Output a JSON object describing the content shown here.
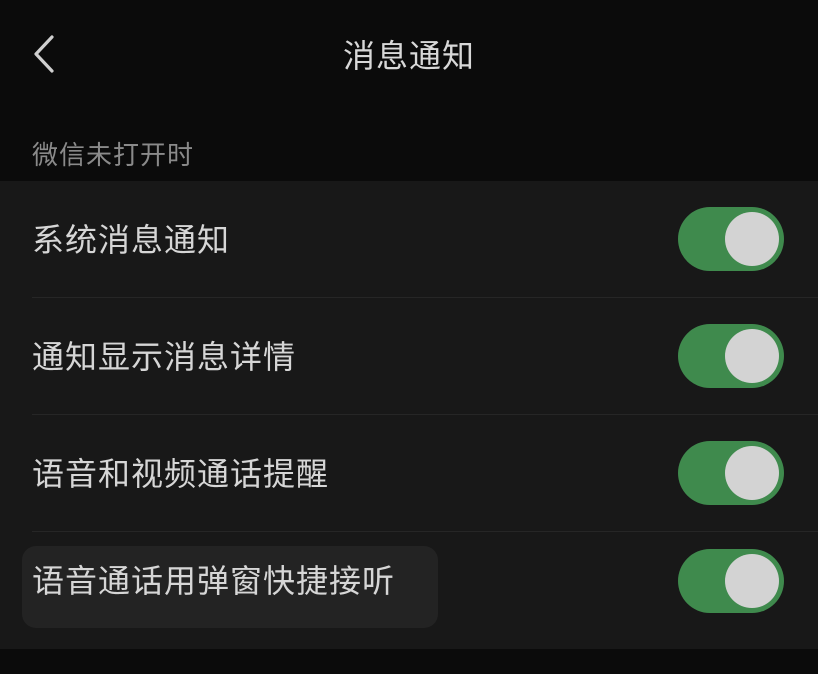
{
  "header": {
    "back_icon": "chevron-left-icon",
    "title": "消息通知"
  },
  "section": {
    "title": "微信未打开时"
  },
  "settings": [
    {
      "label": "系统消息通知",
      "enabled": true
    },
    {
      "label": "通知显示消息详情",
      "enabled": true
    },
    {
      "label": "语音和视频通话提醒",
      "enabled": true
    },
    {
      "label": "语音通话用弹窗快捷接听",
      "enabled": true
    }
  ],
  "colors": {
    "background": "#0b0b0b",
    "list_background": "#181818",
    "toggle_on": "#3f8a4d",
    "toggle_knob": "#d3d3d3"
  }
}
